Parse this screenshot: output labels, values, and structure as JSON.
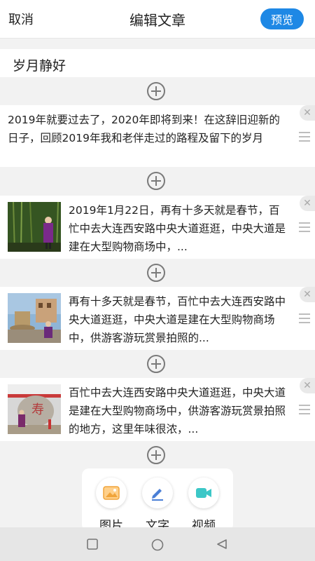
{
  "header": {
    "cancel_label": "取消",
    "title": "编辑文章",
    "preview_label": "预览"
  },
  "article": {
    "title": "岁月静好"
  },
  "cards": [
    {
      "text": "2019年就要过去了，2020年即将到来！在这辞旧迎新的日子，回顾2019年我和老伴走过的路程及留下的岁月",
      "has_image": false
    },
    {
      "text": "2019年1月22日，再有十多天就是春节，百忙中去大连西安路中央大道逛逛，中央大道是建在大型购物商场中，...",
      "has_image": true
    },
    {
      "text": "再有十多天就是春节，百忙中去大连西安路中央大道逛逛，中央大道是建在大型购物商场中，供游客游玩赏景拍照的...",
      "has_image": true
    },
    {
      "text": "百忙中去大连西安路中央大道逛逛，中央大道是建在大型购物商场中，供游客游玩赏景拍照的地方，这里年味很浓，...",
      "has_image": true
    }
  ],
  "toolbar": {
    "image_label": "图片",
    "text_label": "文字",
    "video_label": "视频"
  },
  "icons": {
    "add": "plus-circle-icon",
    "close": "close-icon",
    "menu": "drag-handle-icon",
    "image": "image-icon",
    "text": "pencil-icon",
    "video": "video-camera-icon"
  },
  "colors": {
    "accent": "#1e88e5",
    "background": "#f2f2f2"
  }
}
